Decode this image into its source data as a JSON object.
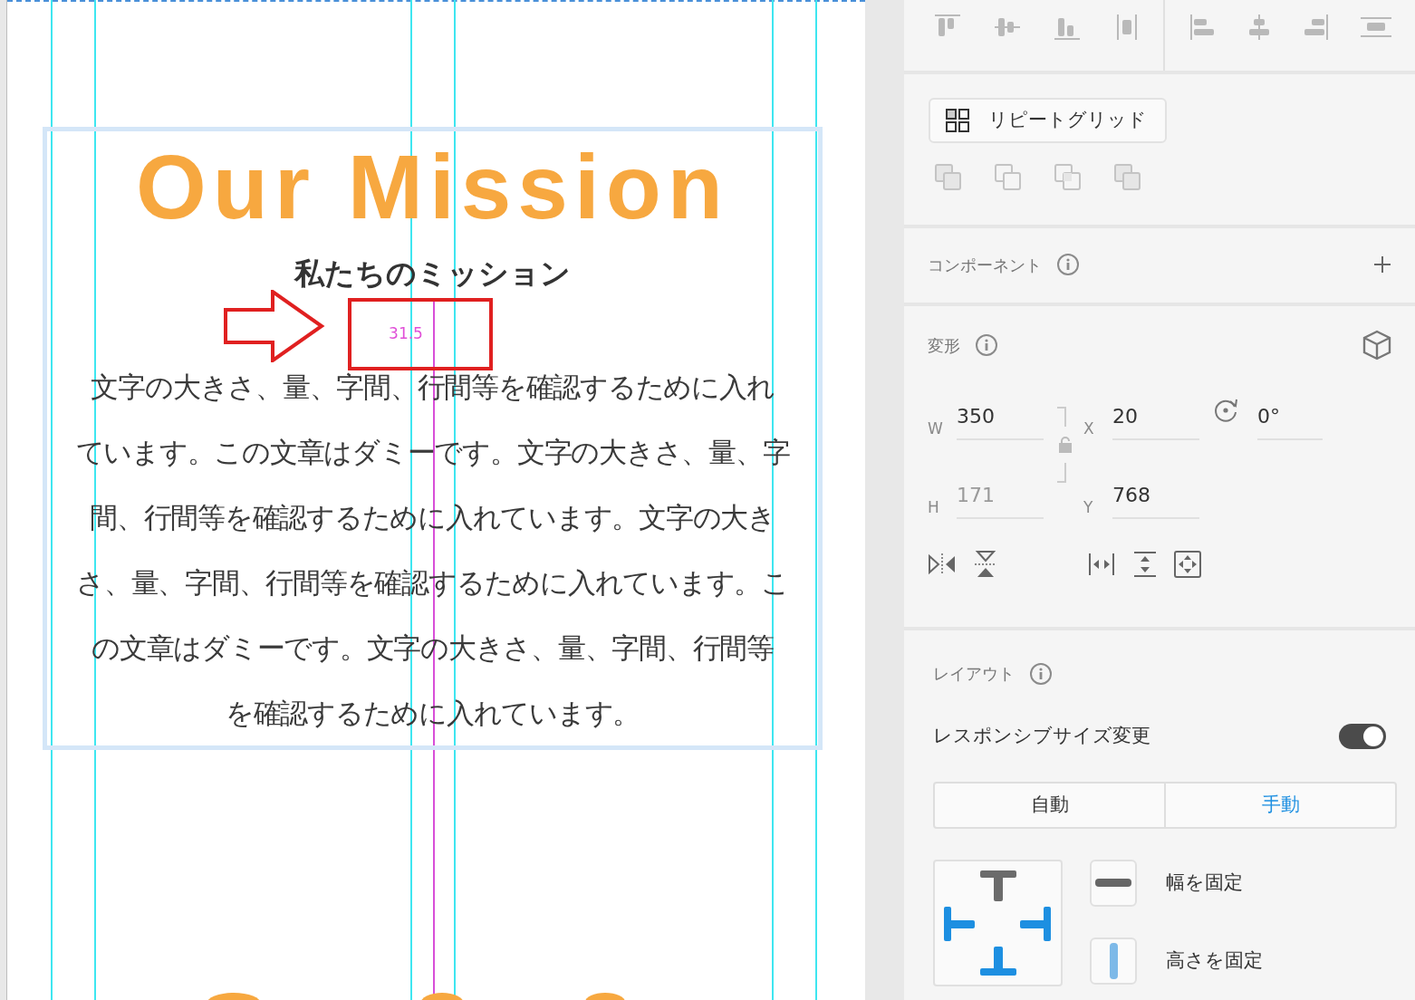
{
  "canvas": {
    "title": "Our Mission",
    "subtitle": "私たちのミッション",
    "spacing_label": "31.5",
    "body_lines": [
      "文字の大きさ、量、字間、行間等を確認するために入れ",
      "ています。この文章はダミーです。文字の大きさ、量、字",
      "間、行間等を確認するために入れています。文字の大き",
      "さ、量、字間、行間等を確認するために入れています。こ",
      "の文章はダミーです。文字の大きさ、量、字間、行間等",
      "を確認するために入れています。"
    ]
  },
  "panel": {
    "repeat_grid": {
      "label": "リピートグリッド"
    },
    "component": {
      "title": "コンポーネント"
    },
    "transform": {
      "title": "変形",
      "aspect_locked": false,
      "rotation": "0°",
      "fields": [
        {
          "label": "W",
          "value": "350",
          "disabled": false
        },
        {
          "label": "X",
          "value": "20",
          "disabled": false
        },
        {
          "label": "H",
          "value": "171",
          "disabled": true
        },
        {
          "label": "Y",
          "value": "768",
          "disabled": false
        }
      ]
    },
    "layout": {
      "title": "レイアウト",
      "responsive_label": "レスポンシブサイズ変更",
      "responsive_on": true,
      "modes": [
        {
          "label": "自動",
          "selected": false
        },
        {
          "label": "手動",
          "selected": true
        }
      ],
      "pins": {
        "top": false,
        "left": true,
        "right": true,
        "bottom": true
      },
      "constraints": [
        {
          "kind": "width",
          "label": "幅を固定",
          "on": false
        },
        {
          "kind": "height",
          "label": "高さを固定",
          "on": true
        }
      ]
    }
  }
}
